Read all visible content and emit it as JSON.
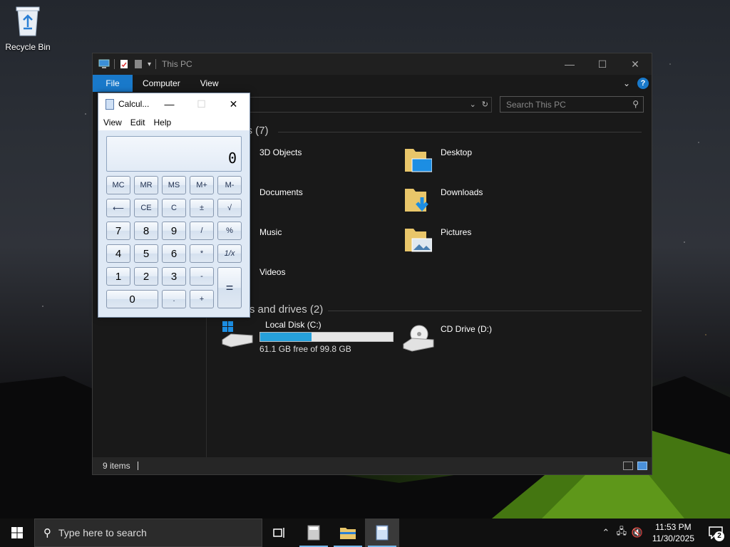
{
  "desktop": {
    "recycle_bin_label": "Recycle Bin"
  },
  "explorer": {
    "title": "This PC",
    "ribbon": {
      "file": "File",
      "computer": "Computer",
      "view": "View",
      "help": "?"
    },
    "search_placeholder": "Search This PC",
    "folders_header": "Folders (7)",
    "folders": [
      {
        "name": "3D Objects"
      },
      {
        "name": "Desktop"
      },
      {
        "name": "Documents"
      },
      {
        "name": "Downloads"
      },
      {
        "name": "Music"
      },
      {
        "name": "Pictures"
      },
      {
        "name": "Videos"
      }
    ],
    "drives_header": "Devices and drives (2)",
    "drives": [
      {
        "name": "Local Disk (C:)",
        "free_text": "61.1 GB free of 99.8 GB",
        "used_fraction": 0.388
      },
      {
        "name": "CD Drive (D:)"
      }
    ],
    "status_items": "9 items",
    "colors": {
      "accent": "#1979ca",
      "bar_fill": "#26a0da"
    }
  },
  "calculator": {
    "title": "Calcul...",
    "menu": {
      "view": "View",
      "edit": "Edit",
      "help": "Help"
    },
    "display": "0",
    "buttons": {
      "mc": "MC",
      "mr": "MR",
      "ms": "MS",
      "mplus": "M+",
      "mminus": "M-",
      "back": "⟵",
      "ce": "CE",
      "c": "C",
      "plusminus": "±",
      "sqrt": "√",
      "n7": "7",
      "n8": "8",
      "n9": "9",
      "div": "/",
      "pct": "%",
      "n4": "4",
      "n5": "5",
      "n6": "6",
      "mul": "*",
      "recip": "1/x",
      "n1": "1",
      "n2": "2",
      "n3": "3",
      "sub": "-",
      "eq": "=",
      "n0": "0",
      "dot": ".",
      "add": "+"
    }
  },
  "taskbar": {
    "search_placeholder": "Type here to search",
    "time": "11:53 PM",
    "date": "11/30/2025",
    "notification_count": "2"
  }
}
